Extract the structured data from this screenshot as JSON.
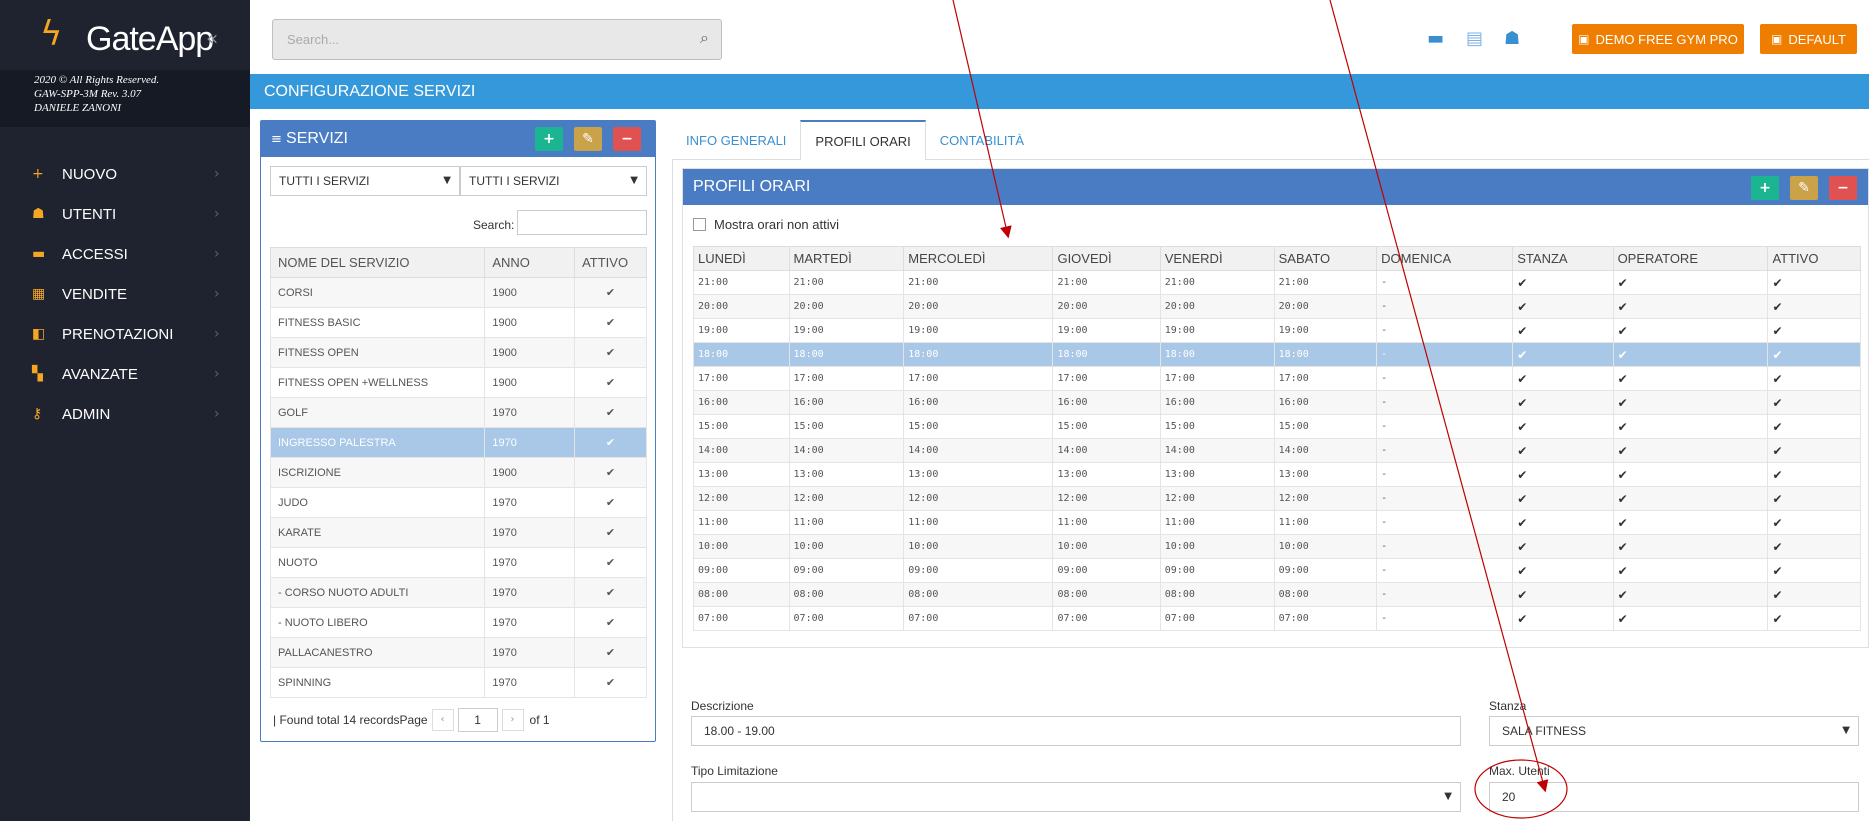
{
  "sidebar": {
    "logo_text": "GateApp",
    "copyright": [
      "2020 © All Rights Reserved.",
      "GAW-SPP-3M Rev. 3.07",
      "DANIELE ZANONI"
    ],
    "items": [
      {
        "label": "NUOVO",
        "icon": "plus-icon",
        "glyph": "+"
      },
      {
        "label": "UTENTI",
        "icon": "users-icon",
        "glyph": "☗"
      },
      {
        "label": "ACCESSI",
        "icon": "card-icon",
        "glyph": "▬"
      },
      {
        "label": "VENDITE",
        "icon": "calculator-icon",
        "glyph": "▦"
      },
      {
        "label": "PRENOTAZIONI",
        "icon": "book-icon",
        "glyph": "◧"
      },
      {
        "label": "AVANZATE",
        "icon": "grid-icon",
        "glyph": "▚"
      },
      {
        "label": "ADMIN",
        "icon": "key-icon",
        "glyph": "⚷"
      }
    ]
  },
  "topbar": {
    "search_placeholder": "Search...",
    "btn_gym": "DEMO FREE GYM PRO",
    "btn_default": "DEFAULT"
  },
  "page_title": "CONFIGURAZIONE SERVIZI",
  "services": {
    "title": "SERVIZI",
    "filter1": "TUTTI I SERVIZI",
    "filter2": "TUTTI I SERVIZI",
    "search_label": "Search:",
    "headers": [
      "NOME DEL SERVIZIO",
      "ANNO",
      "ATTIVO"
    ],
    "rows": [
      {
        "name": "CORSI",
        "year": "1900"
      },
      {
        "name": "FITNESS BASIC",
        "year": "1900"
      },
      {
        "name": "FITNESS OPEN",
        "year": "1900"
      },
      {
        "name": "FITNESS OPEN +WELLNESS",
        "year": "1900"
      },
      {
        "name": "GOLF",
        "year": "1970"
      },
      {
        "name": "INGRESSO PALESTRA",
        "year": "1970"
      },
      {
        "name": "ISCRIZIONE",
        "year": "1900"
      },
      {
        "name": "JUDO",
        "year": "1970"
      },
      {
        "name": "KARATE",
        "year": "1970"
      },
      {
        "name": "NUOTO",
        "year": "1970"
      },
      {
        "name": "- CORSO NUOTO ADULTI",
        "year": "1970"
      },
      {
        "name": "- NUOTO LIBERO",
        "year": "1970"
      },
      {
        "name": "PALLACANESTRO",
        "year": "1970"
      },
      {
        "name": "SPINNING",
        "year": "1970"
      }
    ],
    "selected_index": 5,
    "footer": "| Found total 14 recordsPage",
    "page": "1",
    "of": "of 1"
  },
  "tabs": [
    "INFO GENERALI",
    "PROFILI ORARI",
    "CONTABILITÀ"
  ],
  "active_tab": 1,
  "orari": {
    "title": "PROFILI ORARI",
    "checkbox_label": "Mostra orari non attivi",
    "headers": [
      "LUNEDÌ",
      "MARTEDÌ",
      "MERCOLEDÌ",
      "GIOVEDÌ",
      "VENERDÌ",
      "SABATO",
      "DOMENICA",
      "STANZA",
      "OPERATORE",
      "ATTIVO"
    ],
    "times": [
      "21:00",
      "20:00",
      "19:00",
      "18:00",
      "17:00",
      "16:00",
      "15:00",
      "14:00",
      "13:00",
      "12:00",
      "11:00",
      "10:00",
      "09:00",
      "08:00",
      "07:00"
    ],
    "sunday": "-",
    "selected_index": 3
  },
  "form": {
    "descrizione_label": "Descrizione",
    "descrizione_value": "18.00 - 19.00",
    "stanza_label": "Stanza",
    "stanza_value": "SALA FITNESS",
    "tipo_label": "Tipo Limitazione",
    "tipo_value": "",
    "max_label": "Max. Utenti",
    "max_value": "20"
  },
  "colors": {
    "sidebar_bg": "#1f2330",
    "accent_orange": "#ef7d00",
    "title_blue": "#3498db",
    "panel_blue": "#4a7cc4",
    "annotation_red": "#c00000"
  }
}
